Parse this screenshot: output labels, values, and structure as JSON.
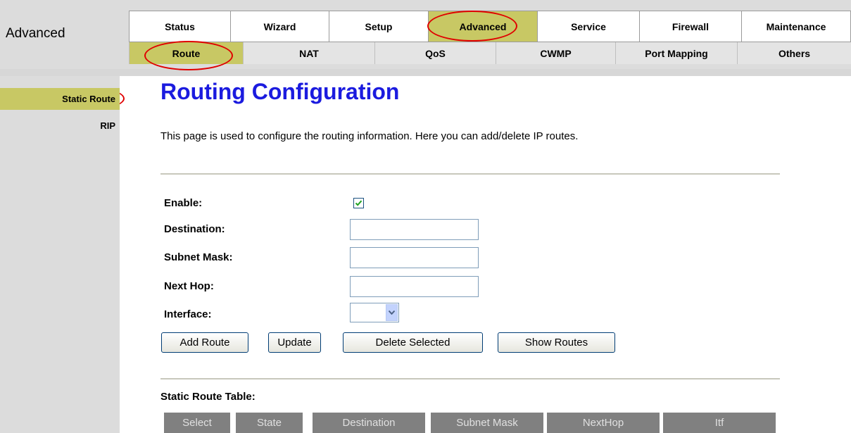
{
  "brand": "Advanced",
  "main_tabs": [
    {
      "label": "Status",
      "active": false
    },
    {
      "label": "Wizard",
      "active": false
    },
    {
      "label": "Setup",
      "active": false
    },
    {
      "label": "Advanced",
      "active": true
    },
    {
      "label": "Service",
      "active": false
    },
    {
      "label": "Firewall",
      "active": false
    },
    {
      "label": "Maintenance",
      "active": false
    }
  ],
  "sub_tabs": [
    {
      "label": "Route",
      "active": true
    },
    {
      "label": "NAT",
      "active": false
    },
    {
      "label": "QoS",
      "active": false
    },
    {
      "label": "CWMP",
      "active": false
    },
    {
      "label": "Port Mapping",
      "active": false
    },
    {
      "label": "Others",
      "active": false
    }
  ],
  "sidebar": {
    "items": [
      {
        "label": "Static Route",
        "active": true
      },
      {
        "label": "RIP",
        "active": false
      }
    ]
  },
  "page": {
    "title": "Routing Configuration",
    "description": "This page is used to configure the routing information. Here you can add/delete IP routes."
  },
  "form": {
    "enable_label": "Enable:",
    "enable_checked": true,
    "destination_label": "Destination:",
    "destination_value": "",
    "subnet_label": "Subnet Mask:",
    "subnet_value": "",
    "nexthop_label": "Next Hop:",
    "nexthop_value": "",
    "interface_label": "Interface:",
    "interface_value": ""
  },
  "buttons": {
    "add": "Add Route",
    "update": "Update",
    "delete": "Delete Selected",
    "show": "Show Routes"
  },
  "table": {
    "title": "Static Route Table:",
    "columns": [
      "Select",
      "State",
      "Destination",
      "Subnet Mask",
      "NextHop",
      "Itf"
    ]
  },
  "colors": {
    "active_tab": "#c8c864",
    "title": "#1b1bdf",
    "highlight_ring": "#e00000",
    "table_header": "#808080"
  }
}
